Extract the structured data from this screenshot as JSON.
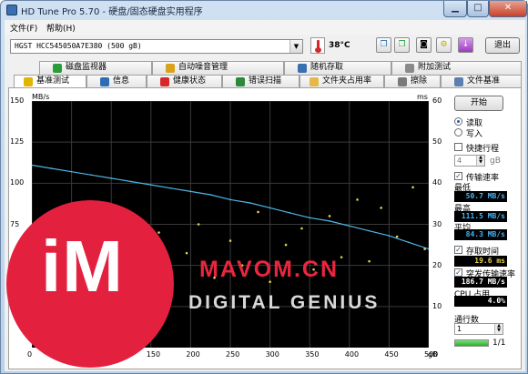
{
  "window": {
    "title": "HD Tune Pro 5.70 - 硬盘/固态硬盘实用程序",
    "minimize_icon": "minimize-icon",
    "maximize_icon": "maximize-icon",
    "close_icon": "close-icon",
    "close_color": "#c7422b"
  },
  "menu": {
    "file": "文件(F)",
    "help": "帮助(H)"
  },
  "toolbar": {
    "drive": "HGST   HCC545050A7E380 (500 gB)",
    "temperature": "38°C",
    "exit_label": "退出",
    "icons": [
      "copy-icon",
      "copy-all-icon",
      "screenshot-icon",
      "settings-icon",
      "save-icon"
    ]
  },
  "tabs_top": [
    {
      "label": "磁盘监视器",
      "icon": "monitor-icon",
      "color": "#2a9d3a"
    },
    {
      "label": "自动噪音管理",
      "icon": "speaker-icon",
      "color": "#d9a21a"
    },
    {
      "label": "随机存取",
      "icon": "random-access-icon",
      "color": "#3a6fb0"
    },
    {
      "label": "附加测试",
      "icon": "extra-tests-icon",
      "color": "#8a8a8a"
    }
  ],
  "tabs_bottom": [
    {
      "label": "基准测试",
      "icon": "benchmark-icon",
      "color": "#e0b400"
    },
    {
      "label": "信息",
      "icon": "info-icon",
      "color": "#2e6db4"
    },
    {
      "label": "健康状态",
      "icon": "health-icon",
      "color": "#d62828"
    },
    {
      "label": "错误扫描",
      "icon": "scan-icon",
      "color": "#2a8a3a"
    },
    {
      "label": "文件夹占用率",
      "icon": "folder-icon",
      "color": "#e6b84a"
    },
    {
      "label": "擦除",
      "icon": "erase-icon",
      "color": "#7a7a7a"
    },
    {
      "label": "文件基准",
      "icon": "file-benchmark-icon",
      "color": "#5a7fb0"
    }
  ],
  "chart_data": {
    "type": "line",
    "xlabel": "",
    "x_unit": "gB",
    "ylabel": "MB/s",
    "y2label": "ms",
    "xlim": [
      0,
      500
    ],
    "ylim": [
      0,
      150
    ],
    "y2lim": [
      0,
      60
    ],
    "x_ticks": [
      0,
      50,
      100,
      150,
      200,
      250,
      300,
      350,
      400,
      450,
      500
    ],
    "y_ticks": [
      25,
      50,
      75,
      100,
      125,
      150
    ],
    "y2_ticks": [
      10,
      20,
      30,
      40,
      50,
      60
    ],
    "grid": true,
    "series": [
      {
        "color": "#4fb6e8",
        "x": [
          0,
          25,
          50,
          75,
          100,
          125,
          150,
          175,
          200,
          225,
          250,
          275,
          300,
          325,
          350,
          375,
          400,
          425,
          450,
          475,
          500
        ],
        "values": [
          111,
          109,
          107,
          105,
          103,
          101,
          99,
          97,
          95,
          93,
          90,
          88,
          85,
          82,
          79,
          77,
          74,
          71,
          68,
          64,
          60
        ]
      },
      {
        "color": "#e6d24a",
        "style": "scatter",
        "x": [
          10,
          30,
          55,
          80,
          95,
          120,
          140,
          160,
          175,
          195,
          210,
          230,
          250,
          265,
          285,
          300,
          320,
          340,
          355,
          375,
          390,
          410,
          425,
          440,
          460,
          480,
          495
        ],
        "values": [
          22,
          15,
          27,
          21,
          31,
          18,
          24,
          28,
          14,
          23,
          30,
          17,
          26,
          20,
          33,
          16,
          25,
          29,
          19,
          32,
          22,
          36,
          21,
          34,
          27,
          39,
          24
        ]
      }
    ]
  },
  "right_panel": {
    "start_label": "开始",
    "read_label": "读取",
    "write_label": "写入",
    "read_selected": true,
    "short_stroke_label": "快捷行程",
    "short_stroke_value": "4",
    "short_stroke_unit": "gB",
    "transfer_rate_label": "传输速率",
    "min_label": "最低",
    "min_value": "50.7 MB/s",
    "max_label": "最高",
    "max_value": "111.5 MB/s",
    "avg_label": "平均",
    "avg_value": "84.3 MB/s",
    "access_time_label": "存取时间",
    "access_time_value": "19.6 ms",
    "burst_rate_label": "突发传输速率",
    "burst_rate_value": "186.7 MB/s",
    "cpu_label": "CPU 占用",
    "cpu_value": "4.0%",
    "passes_label": "通行数",
    "passes_value": "1",
    "progress_text": "1/1",
    "progress_fraction": 1.0
  },
  "watermark": {
    "logo": "iM",
    "brand": "MAVOM.CN",
    "tagline": "DIGITAL GENIUS"
  }
}
